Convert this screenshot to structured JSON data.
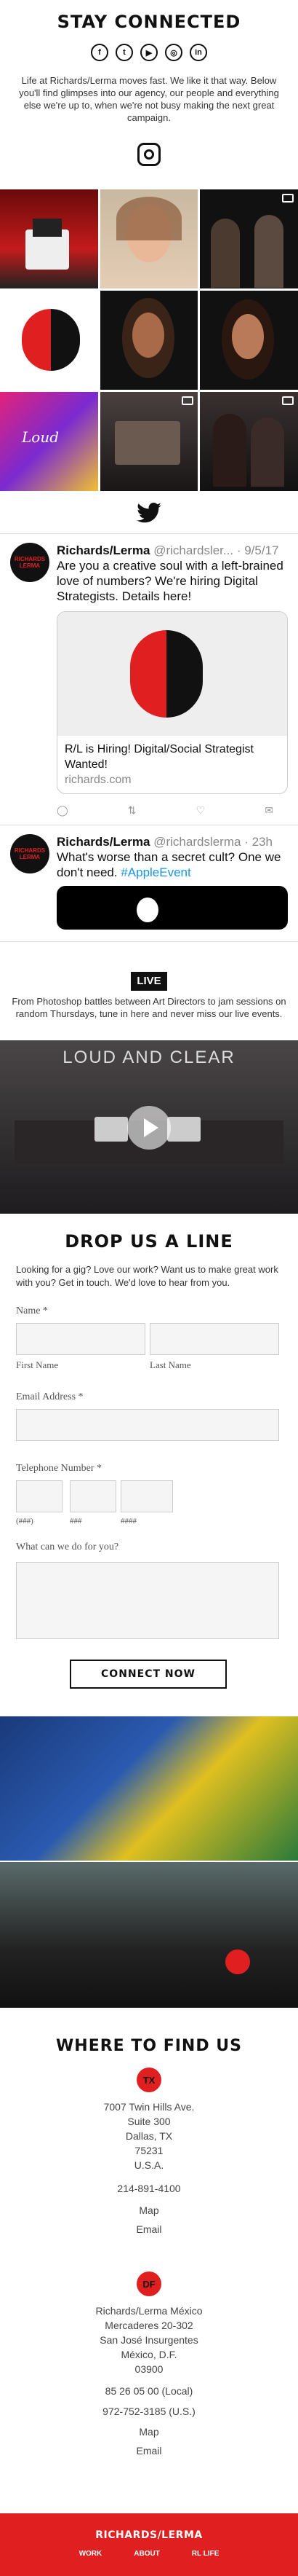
{
  "stay": {
    "title": "STAY CONNECTED",
    "intro": "Life at Richards/Lerma moves fast. We like it that way. Below you'll find glimpses into our agency, our people and everything else we're up to, when we're not busy making the next great campaign.",
    "icons": [
      "facebook-icon",
      "twitter-icon",
      "youtube-icon",
      "instagram-icon",
      "linkedin-icon"
    ],
    "glyphs": [
      "f",
      "t",
      "▶",
      "◎",
      "in"
    ]
  },
  "tweets": [
    {
      "name": "Richards/Lerma",
      "handle": "@richardsler...",
      "time": "· 9/5/17",
      "text": "Are you a creative soul with a left-brained love of numbers? We're hiring Digital Strategists. Details here!",
      "card_title": "R/L is Hiring! Digital/Social Strategist Wanted!",
      "card_domain": "richards.com"
    },
    {
      "name": "Richards/Lerma",
      "handle": "@richardslerma",
      "time": "· 23h",
      "text": "What's worse than a secret cult? One we don't need. ",
      "hashtag": "#AppleEvent"
    }
  ],
  "avatar_text": "RICHARDS LERMA",
  "live": {
    "badge": "LIVE",
    "text": "From Photoshop battles between Art Directors to jam sessions on random Thursdays, tune in here and never miss our live events.",
    "video_title": "LOUD AND CLEAR"
  },
  "form": {
    "title": "DROP US A LINE",
    "intro": "Looking for a gig? Love our work? Want us to make great work with you? Get in touch. We'd love to hear from you.",
    "name_label": "Name *",
    "first": "First Name",
    "last": "Last Name",
    "email_label": "Email Address *",
    "phone_label": "Telephone Number *",
    "p1": "(###)",
    "p2": "###",
    "p3": "####",
    "msg_label": "What can we do for you?",
    "submit": "CONNECT NOW"
  },
  "find": {
    "title": "WHERE TO FIND US",
    "tx": {
      "badge": "TX",
      "l1": "7007 Twin Hills Ave.",
      "l2": "Suite 300",
      "l3": "Dallas, TX",
      "l4": "75231",
      "l5": "U.S.A.",
      "phone": "214-891-4100",
      "map": "Map",
      "email": "Email"
    },
    "df": {
      "badge": "DF",
      "l1": "Richards/Lerma México",
      "l2": "Mercaderes 20-302",
      "l3": "San José Insurgentes",
      "l4": "México, D.F.",
      "l5": "03900",
      "phone1": "85 26 05 00 (Local)",
      "phone2": "972-752-3185 (U.S.)",
      "map": "Map",
      "email": "Email"
    }
  },
  "footer": {
    "logo": "RICHARDS/LERMA",
    "nav": [
      "WORK",
      "ABOUT",
      "RL LIFE"
    ]
  }
}
